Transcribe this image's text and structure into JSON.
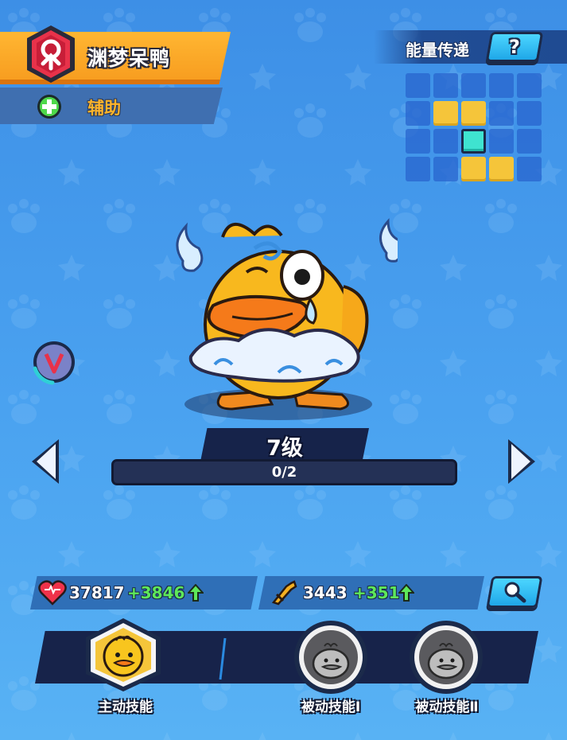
{
  "hero": {
    "name": "渊梦呆鸭",
    "role_icon": "role-emblem-icon",
    "type_label": "辅助",
    "type_icon": "plus-icon"
  },
  "energy": {
    "label": "能量传递",
    "help_label": "?",
    "grid": [
      [
        "empty",
        "empty",
        "empty",
        "empty",
        "empty"
      ],
      [
        "empty",
        "yellow",
        "yellow",
        "empty",
        "empty"
      ],
      [
        "empty",
        "empty",
        "center",
        "empty",
        "empty"
      ],
      [
        "empty",
        "empty",
        "yellow",
        "yellow",
        "empty"
      ]
    ]
  },
  "level": {
    "label": "7级",
    "progress_text": "0/2",
    "progress": 0
  },
  "stats": {
    "hp_value": "37817",
    "hp_bonus": "+3846",
    "atk_value": "3443",
    "atk_bonus": "+351"
  },
  "skills": [
    {
      "label": "主动技能",
      "state": "unlocked"
    },
    {
      "label": "被动技能Ⅰ",
      "state": "locked"
    },
    {
      "label": "被动技能Ⅱ",
      "state": "locked"
    }
  ],
  "colors": {
    "accent_orange": "#f79b1e",
    "accent_cyan": "#1fa7e8",
    "bonus_green": "#5ee85a",
    "energy_yellow": "#f5c53a",
    "energy_center": "#3fe3d0"
  }
}
